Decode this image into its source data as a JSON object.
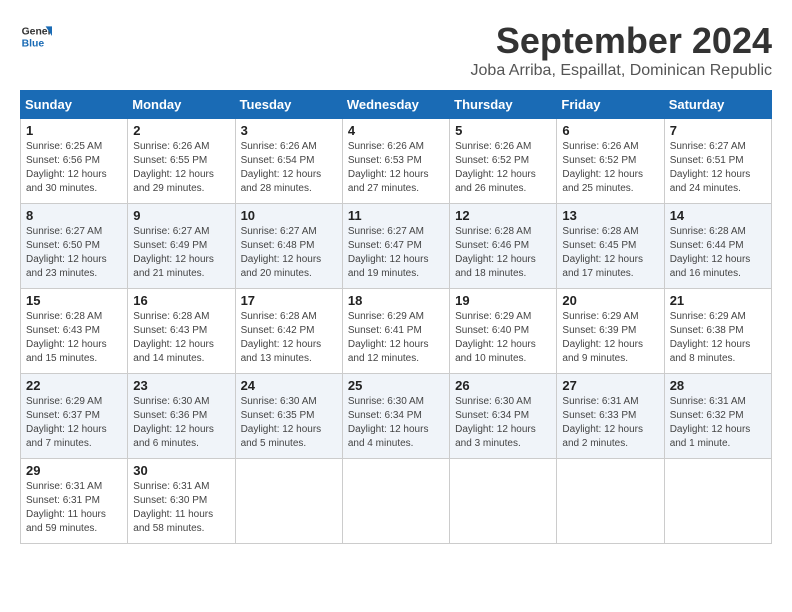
{
  "logo": {
    "text_general": "General",
    "text_blue": "Blue"
  },
  "title": "September 2024",
  "subtitle": "Joba Arriba, Espaillat, Dominican Republic",
  "days_header": [
    "Sunday",
    "Monday",
    "Tuesday",
    "Wednesday",
    "Thursday",
    "Friday",
    "Saturday"
  ],
  "weeks": [
    [
      {
        "day": "1",
        "sunrise": "6:25 AM",
        "sunset": "6:56 PM",
        "daylight": "12 hours and 30 minutes."
      },
      {
        "day": "2",
        "sunrise": "6:26 AM",
        "sunset": "6:55 PM",
        "daylight": "12 hours and 29 minutes."
      },
      {
        "day": "3",
        "sunrise": "6:26 AM",
        "sunset": "6:54 PM",
        "daylight": "12 hours and 28 minutes."
      },
      {
        "day": "4",
        "sunrise": "6:26 AM",
        "sunset": "6:53 PM",
        "daylight": "12 hours and 27 minutes."
      },
      {
        "day": "5",
        "sunrise": "6:26 AM",
        "sunset": "6:52 PM",
        "daylight": "12 hours and 26 minutes."
      },
      {
        "day": "6",
        "sunrise": "6:26 AM",
        "sunset": "6:52 PM",
        "daylight": "12 hours and 25 minutes."
      },
      {
        "day": "7",
        "sunrise": "6:27 AM",
        "sunset": "6:51 PM",
        "daylight": "12 hours and 24 minutes."
      }
    ],
    [
      {
        "day": "8",
        "sunrise": "6:27 AM",
        "sunset": "6:50 PM",
        "daylight": "12 hours and 23 minutes."
      },
      {
        "day": "9",
        "sunrise": "6:27 AM",
        "sunset": "6:49 PM",
        "daylight": "12 hours and 21 minutes."
      },
      {
        "day": "10",
        "sunrise": "6:27 AM",
        "sunset": "6:48 PM",
        "daylight": "12 hours and 20 minutes."
      },
      {
        "day": "11",
        "sunrise": "6:27 AM",
        "sunset": "6:47 PM",
        "daylight": "12 hours and 19 minutes."
      },
      {
        "day": "12",
        "sunrise": "6:28 AM",
        "sunset": "6:46 PM",
        "daylight": "12 hours and 18 minutes."
      },
      {
        "day": "13",
        "sunrise": "6:28 AM",
        "sunset": "6:45 PM",
        "daylight": "12 hours and 17 minutes."
      },
      {
        "day": "14",
        "sunrise": "6:28 AM",
        "sunset": "6:44 PM",
        "daylight": "12 hours and 16 minutes."
      }
    ],
    [
      {
        "day": "15",
        "sunrise": "6:28 AM",
        "sunset": "6:43 PM",
        "daylight": "12 hours and 15 minutes."
      },
      {
        "day": "16",
        "sunrise": "6:28 AM",
        "sunset": "6:43 PM",
        "daylight": "12 hours and 14 minutes."
      },
      {
        "day": "17",
        "sunrise": "6:28 AM",
        "sunset": "6:42 PM",
        "daylight": "12 hours and 13 minutes."
      },
      {
        "day": "18",
        "sunrise": "6:29 AM",
        "sunset": "6:41 PM",
        "daylight": "12 hours and 12 minutes."
      },
      {
        "day": "19",
        "sunrise": "6:29 AM",
        "sunset": "6:40 PM",
        "daylight": "12 hours and 10 minutes."
      },
      {
        "day": "20",
        "sunrise": "6:29 AM",
        "sunset": "6:39 PM",
        "daylight": "12 hours and 9 minutes."
      },
      {
        "day": "21",
        "sunrise": "6:29 AM",
        "sunset": "6:38 PM",
        "daylight": "12 hours and 8 minutes."
      }
    ],
    [
      {
        "day": "22",
        "sunrise": "6:29 AM",
        "sunset": "6:37 PM",
        "daylight": "12 hours and 7 minutes."
      },
      {
        "day": "23",
        "sunrise": "6:30 AM",
        "sunset": "6:36 PM",
        "daylight": "12 hours and 6 minutes."
      },
      {
        "day": "24",
        "sunrise": "6:30 AM",
        "sunset": "6:35 PM",
        "daylight": "12 hours and 5 minutes."
      },
      {
        "day": "25",
        "sunrise": "6:30 AM",
        "sunset": "6:34 PM",
        "daylight": "12 hours and 4 minutes."
      },
      {
        "day": "26",
        "sunrise": "6:30 AM",
        "sunset": "6:34 PM",
        "daylight": "12 hours and 3 minutes."
      },
      {
        "day": "27",
        "sunrise": "6:31 AM",
        "sunset": "6:33 PM",
        "daylight": "12 hours and 2 minutes."
      },
      {
        "day": "28",
        "sunrise": "6:31 AM",
        "sunset": "6:32 PM",
        "daylight": "12 hours and 1 minute."
      }
    ],
    [
      {
        "day": "29",
        "sunrise": "6:31 AM",
        "sunset": "6:31 PM",
        "daylight": "11 hours and 59 minutes."
      },
      {
        "day": "30",
        "sunrise": "6:31 AM",
        "sunset": "6:30 PM",
        "daylight": "11 hours and 58 minutes."
      },
      null,
      null,
      null,
      null,
      null
    ]
  ]
}
